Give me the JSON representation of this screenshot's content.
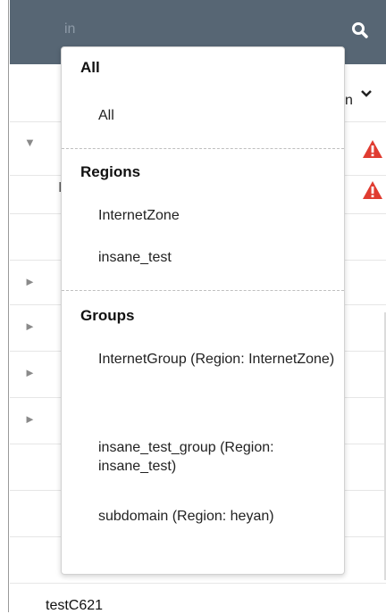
{
  "search": {
    "value": "in"
  },
  "dropdown": {
    "sections": [
      {
        "header": "All",
        "options": [
          "All"
        ]
      },
      {
        "header": "Regions",
        "options": [
          "InternetZone",
          "insane_test"
        ]
      },
      {
        "header": "Groups",
        "options": [
          "InternetGroup (Region: InternetZone)",
          "insane_test_group (Region: insane_test)",
          "subdomain (Region: heyan)"
        ]
      }
    ]
  },
  "background": {
    "header_peek": "n",
    "row_peek": "I",
    "bottom_peek": "testC621"
  },
  "colors": {
    "topbar": "#576674",
    "warning": "#e03c31"
  }
}
